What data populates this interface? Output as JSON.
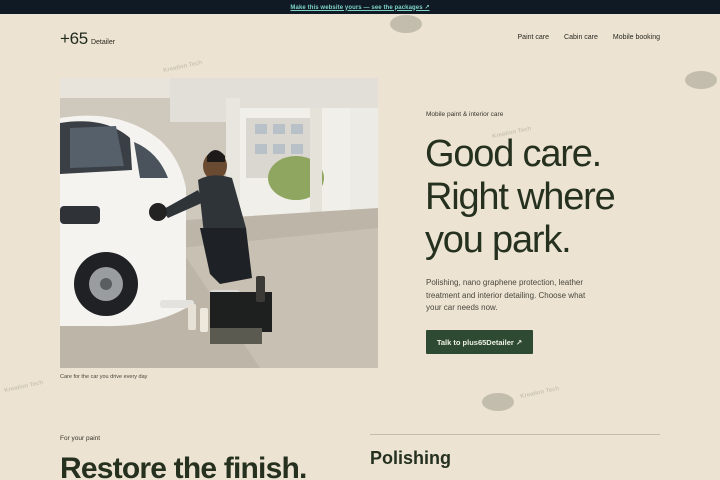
{
  "banner": {
    "text": "Make this website yours — see the packages ↗"
  },
  "brand": {
    "number": "+65",
    "name": "Detailer"
  },
  "nav": {
    "items": [
      "Paint care",
      "Cabin care",
      "Mobile booking"
    ]
  },
  "hero": {
    "image_alt": "Detailer polishing a white car in a parking garage",
    "caption": "Care for the car you drive every day",
    "eyebrow": "Mobile paint & interior care",
    "headline_lines": [
      "Good care.",
      "Right where",
      "you park."
    ],
    "lead": "Polishing, nano graphene protection, leather treatment and interior detailing. Choose what your car needs now.",
    "cta_label": "Talk to plus65Detailer ↗"
  },
  "paint_section": {
    "eyebrow": "For your paint",
    "title": "Restore the finish.",
    "sub_title": "Polishing"
  },
  "watermark": {
    "text": "Kreation Tech"
  },
  "colors": {
    "page_bg": "#ece3d2",
    "banner_bg": "#0f1a24",
    "banner_link": "#7fd3c7",
    "heading": "#25301f",
    "cta_bg": "#2f4a32"
  }
}
